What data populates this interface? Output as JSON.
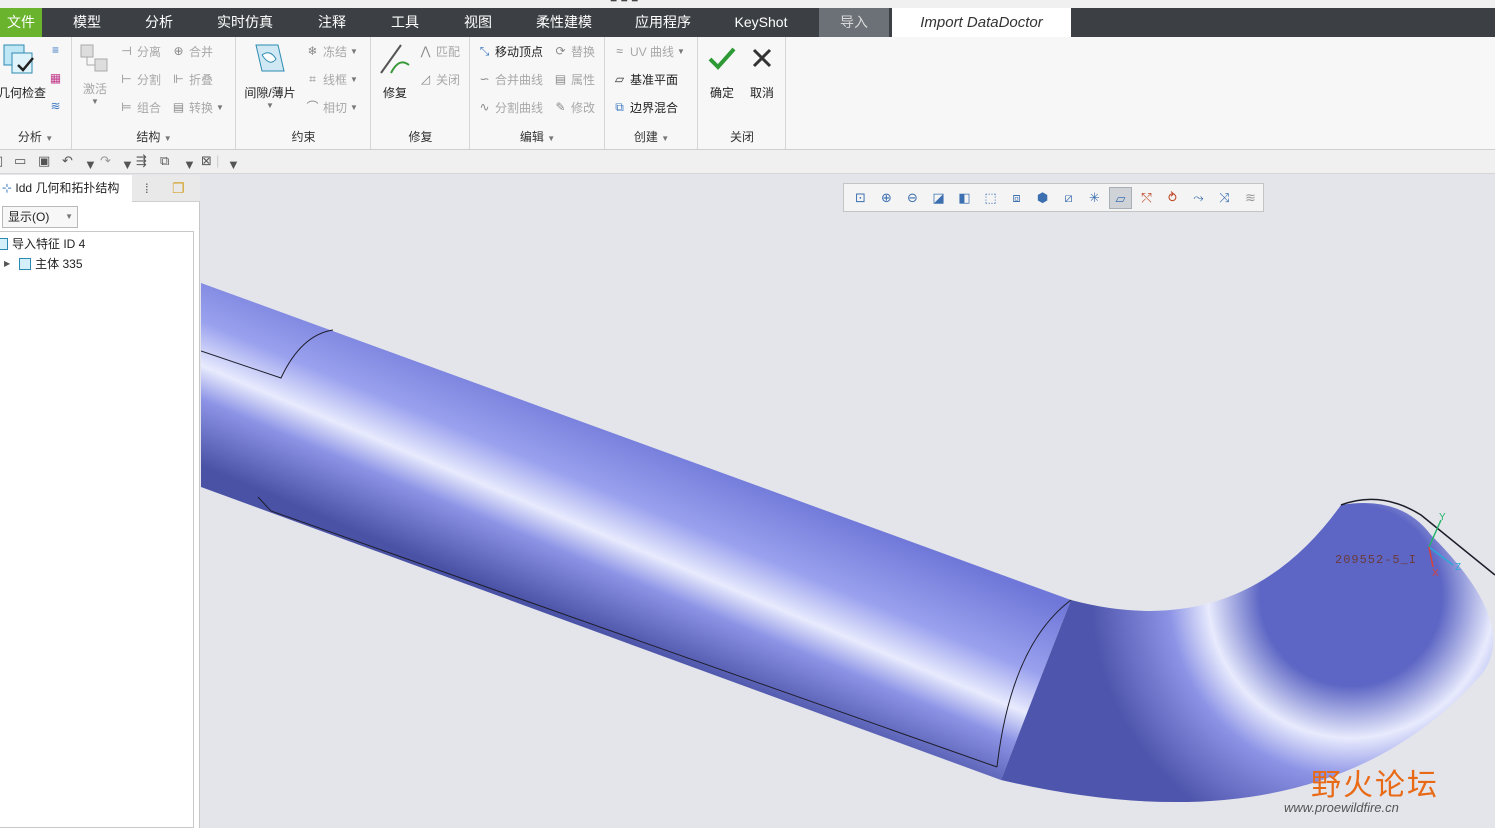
{
  "menu": {
    "tabs": [
      {
        "label": "文件",
        "kind": "file"
      },
      {
        "label": "模型"
      },
      {
        "label": "分析"
      },
      {
        "label": "实时仿真"
      },
      {
        "label": "注释"
      },
      {
        "label": "工具"
      },
      {
        "label": "视图"
      },
      {
        "label": "柔性建模"
      },
      {
        "label": "应用程序"
      },
      {
        "label": "KeyShot"
      },
      {
        "label": "导入",
        "kind": "import"
      },
      {
        "label": "Import DataDoctor",
        "kind": "active"
      }
    ]
  },
  "ribbon": {
    "analysis": {
      "label": "分析",
      "geometry_check": "几何检查"
    },
    "structure": {
      "label": "结构",
      "activate": "激活",
      "separate": "分离",
      "merge": "合并",
      "split": "分割",
      "fold": "折叠",
      "combine": "组合",
      "convert": "转换"
    },
    "constraint": {
      "label": "约束",
      "gap_sheet": "间隙/薄片",
      "freeze": "冻结",
      "wireframe": "线框",
      "tangent": "相切"
    },
    "repair": {
      "label": "修复",
      "repair": "修复",
      "match": "匹配",
      "close": "关闭"
    },
    "edit": {
      "label": "编辑",
      "move_vertex": "移动顶点",
      "replace": "替换",
      "merge_curves": "合并曲线",
      "properties": "属性",
      "split_curves": "分割曲线",
      "modify": "修改"
    },
    "create": {
      "label": "创建",
      "uv_curve": "UV 曲线",
      "datum_plane": "基准平面",
      "boundary_blend": "边界混合"
    },
    "close": {
      "label": "关闭",
      "ok": "确定",
      "cancel": "取消"
    }
  },
  "left_panel": {
    "tab_title": "Idd 几何和拓扑结构",
    "show_dropdown": "显示(O)",
    "tree": [
      {
        "label": "导入特征 ID 4",
        "level": 0
      },
      {
        "label": "主体 335",
        "level": 1
      }
    ]
  },
  "graphics": {
    "csys_label": "209552-5_I",
    "axis_x": "X",
    "axis_y": "Y",
    "axis_z": "Z",
    "watermark_cn": "野火论坛",
    "watermark_url": "www.proewildfire.cn",
    "pipe_color": "#8c93e6"
  }
}
